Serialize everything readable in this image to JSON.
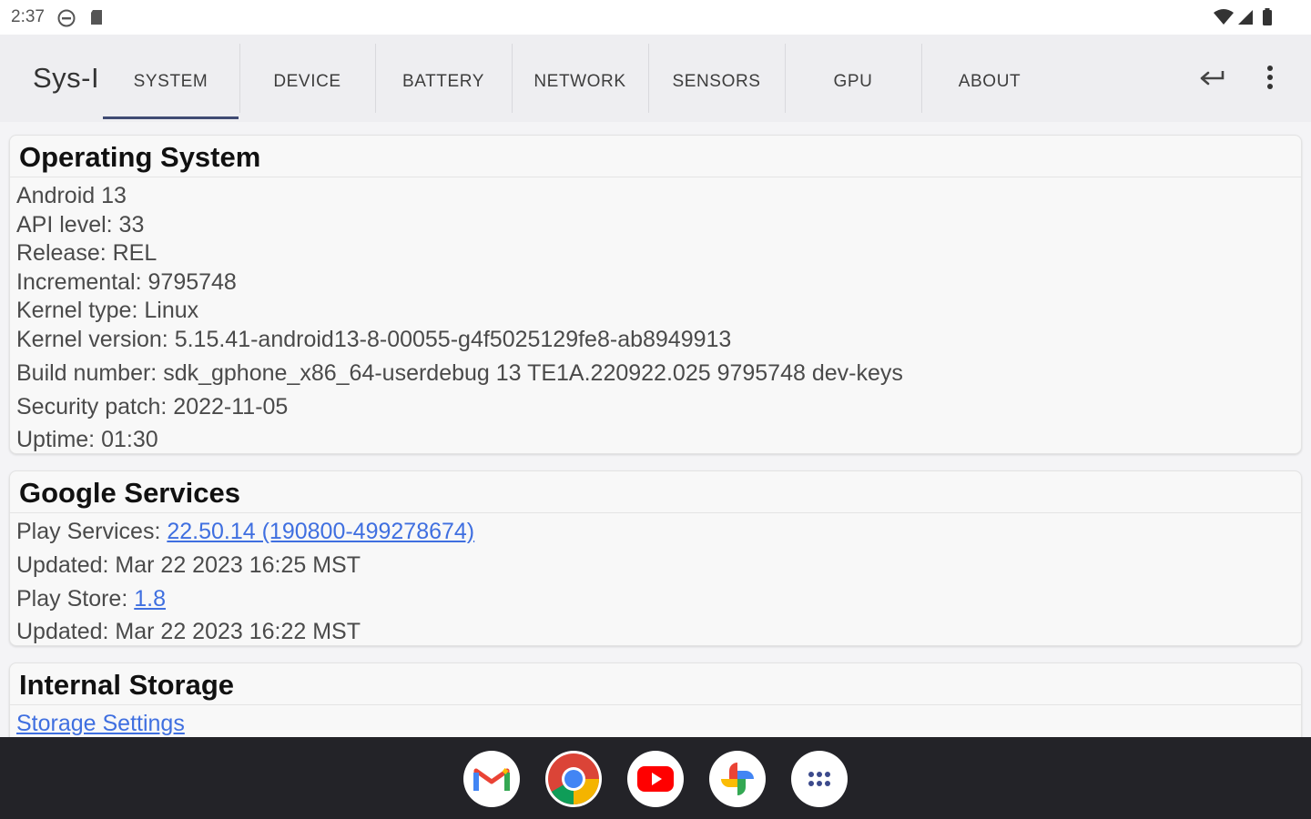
{
  "status_bar": {
    "time": "2:37"
  },
  "app_bar": {
    "title": "Sys-I",
    "tabs": [
      {
        "label": "SYSTEM",
        "selected": true
      },
      {
        "label": "DEVICE"
      },
      {
        "label": "BATTERY"
      },
      {
        "label": "NETWORK"
      },
      {
        "label": "SENSORS"
      },
      {
        "label": "GPU"
      },
      {
        "label": "ABOUT"
      }
    ],
    "actions": [
      "share-icon",
      "more-vert-icon"
    ]
  },
  "operating_system": {
    "title": "Operating System",
    "rows": [
      "Android 13",
      "API level: 33",
      "Release: REL",
      "Incremental: 9795748",
      "Kernel type: Linux",
      "Kernel version: 5.15.41-android13-8-00055-g4f5025129fe8-ab8949913",
      "Build number: sdk_gphone_x86_64-userdebug 13 TE1A.220922.025 9795748 dev-keys",
      "Security patch: 2022-11-05",
      "Uptime: 01:30"
    ]
  },
  "google_services": {
    "title": "Google Services",
    "play_services_label": "Play Services: ",
    "play_services_version": "22.50.14 (190800-499278674)",
    "play_services_updated": "Updated: Mar 22 2023 16:25 MST",
    "play_store_label": "Play Store: ",
    "play_store_version": "1.8",
    "play_store_updated": "Updated: Mar 22 2023 16:22 MST"
  },
  "internal_storage": {
    "title": "Internal Storage",
    "settings_link": "Storage Settings"
  },
  "taskbar": {
    "apps": [
      "gmail-icon",
      "chrome-icon",
      "youtube-icon",
      "photos-icon",
      "app-drawer-icon"
    ]
  },
  "colors": {
    "link": "#3f6fe0",
    "tab_indicator": "#3f4b73",
    "taskbar": "#232328"
  }
}
